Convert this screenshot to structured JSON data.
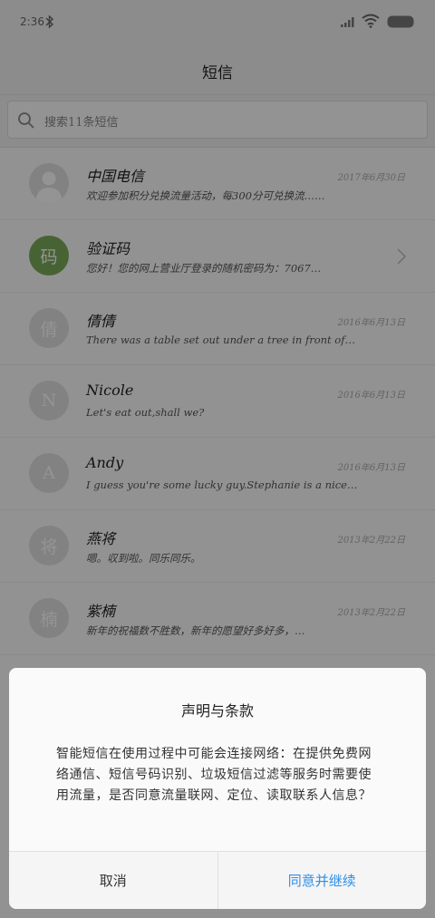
{
  "status_bar": {
    "time": "2:36"
  },
  "header": {
    "title": "短信"
  },
  "search": {
    "placeholder": "搜索11条短信"
  },
  "conversations": [
    {
      "name": "中国电信",
      "preview": "欢迎参加积分兑换流量活动，每300分可兑换流……",
      "date": "2017年6月30日",
      "avatar_text": "",
      "avatar_type": "person"
    },
    {
      "name": "验证码",
      "preview": "您好！您的网上营业厅登录的随机密码为：7067…",
      "date": "",
      "avatar_text": "码",
      "avatar_type": "green"
    },
    {
      "name": "倩倩",
      "preview": "There was a table set out under a tree in front of the hous",
      "date": "2016年6月13日",
      "avatar_text": "倩",
      "avatar_type": "gray"
    },
    {
      "name": "Nicole",
      "preview": "Let's eat out,shall we?",
      "date": "2016年6月13日",
      "avatar_text": "N",
      "avatar_type": "gray"
    },
    {
      "name": "Andy",
      "preview": "I guess you're some lucky guy.Stephanie is a nice girl.",
      "date": "2016年6月13日",
      "avatar_text": "A",
      "avatar_type": "gray"
    },
    {
      "name": "燕将",
      "preview": "嗯。収到啦。同乐同乐。",
      "date": "2013年2月22日",
      "avatar_text": "将",
      "avatar_type": "gray"
    },
    {
      "name": "紫楠",
      "preview": "新年的祝福数不胜数，新年的愿望好多好多，…",
      "date": "2013年2月22日",
      "avatar_text": "楠",
      "avatar_type": "gray"
    }
  ],
  "dialog": {
    "title": "声明与条款",
    "body": "智能短信在使用过程中可能会连接网络：在提供免费网络通信、短信号码识别、垃圾短信过滤等服务时需要使用流量，是否同意流量联网、定位、读取联系人信息？",
    "cancel_label": "取消",
    "confirm_label": "同意并继续"
  },
  "colors": {
    "accent": "#2f8fe8",
    "avatar_green": "#7bab5a"
  }
}
